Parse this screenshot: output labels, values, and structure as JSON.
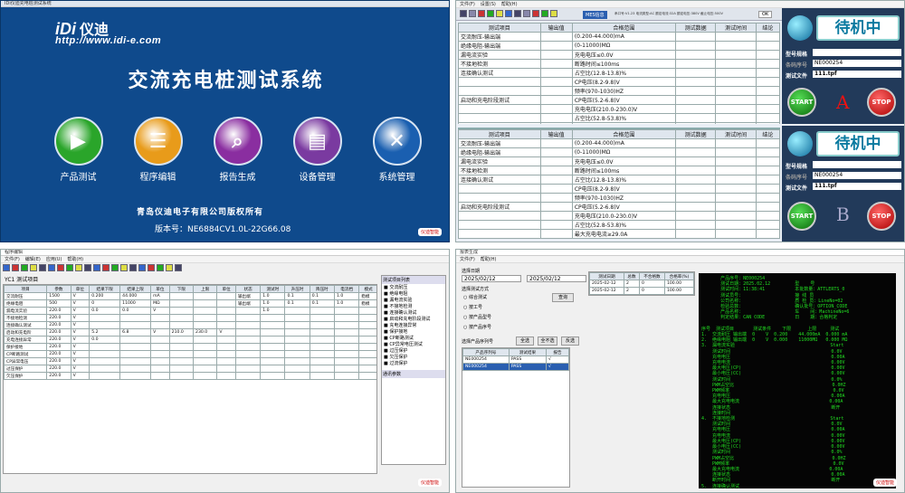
{
  "home": {
    "window_title": "IDi仪迪充电桩测试系统",
    "logo": "iDi",
    "logo_cn": "仪迪",
    "url": "http://www.idi-e.com",
    "title": "交流充电桩测试系统",
    "buttons": [
      {
        "label": "产品测试",
        "icon": "play-icon",
        "color": "#2aa52a"
      },
      {
        "label": "程序编辑",
        "icon": "document-icon",
        "color": "#e89b1a"
      },
      {
        "label": "报告生成",
        "icon": "magnifier-icon",
        "color": "#8a2ea0"
      },
      {
        "label": "设备管理",
        "icon": "bar-chart-icon",
        "color": "#7a3aa0"
      },
      {
        "label": "系统管理",
        "icon": "tools-icon",
        "color": "#1a5fb0"
      }
    ],
    "copyright": "青岛仪迪电子有限公司版权所有",
    "version_label": "版本号：",
    "version": "NE6884CV1.0L-22G66.08",
    "brand": "仪迪智能"
  },
  "test": {
    "menu": [
      "文件(F)",
      "设置(S)",
      "帮助(H)"
    ],
    "mes_label": "MES信息",
    "status_line": "串口号:V1.23 电流类型:AC 额定电流:32A 额定电压:380V 截止电压:500V",
    "ok_label": "OK",
    "columns": [
      "测试项目",
      "输出值",
      "合格范围",
      "测试数据",
      "测试时间",
      "结论"
    ],
    "rows": [
      [
        "交流耐压-输出端",
        "",
        "(0.200-44.000)mA",
        "",
        "",
        ""
      ],
      [
        "绝缘电阻-输出端",
        "",
        "(0-11000)MΩ",
        "",
        "",
        ""
      ],
      [
        "漏电流实验",
        "",
        "充电电压≤0.0V",
        "",
        "",
        ""
      ],
      [
        "不接地检测",
        "",
        "断路时间≤100ms",
        "",
        "",
        ""
      ],
      [
        "连接确认测试",
        "",
        "占空比(12.8-13.8)%",
        "",
        "",
        ""
      ],
      [
        "",
        "",
        "CP电压(8.2-9.8)V",
        "",
        "",
        ""
      ],
      [
        "",
        "",
        "频率(970-1030)HZ",
        "",
        "",
        ""
      ],
      [
        "启动和充电阶段测试",
        "",
        "CP电压(5.2-6.8)V",
        "",
        "",
        ""
      ],
      [
        "",
        "",
        "充电电压(210.0-230.0)V",
        "",
        "",
        ""
      ],
      [
        "",
        "",
        "占空比(52.8-53.8)%",
        "",
        "",
        ""
      ],
      [
        "",
        "",
        "最大充电电流≥29.0A",
        "",
        "",
        ""
      ]
    ],
    "standby": "待机中",
    "model_label": "型号规格",
    "serial_label": "条码序号",
    "serial_value": "NE000254",
    "file_label": "测试文件",
    "file_value": "111.tpf",
    "start": "START",
    "stop": "STOP",
    "station_a": "A",
    "station_b": "B"
  },
  "editor": {
    "window_title": "程序编辑",
    "menu": [
      "文件(F)",
      "编辑(E)",
      "应用(U)",
      "帮助(H)"
    ],
    "section": "YC1 测试项目",
    "columns": [
      "项目",
      "参数",
      "单位",
      "结果下限",
      "结果上限",
      "单位",
      "下限",
      "上限",
      "单位",
      "状态",
      "测试时",
      "升压时",
      "降压时",
      "电流档",
      "模式"
    ],
    "rows": [
      [
        "交流耐压",
        "1500",
        "V",
        "0.200",
        "44.000",
        "mA",
        "",
        "",
        "",
        "输出端",
        "1.0",
        "0.1",
        "0.1",
        "1.0",
        "稳模"
      ],
      [
        "绝缘电阻",
        "500",
        "V",
        "0",
        "11000",
        "MΩ",
        "",
        "",
        "",
        "输出端",
        "1.0",
        "0.1",
        "0.1",
        "1.0",
        "稳模"
      ],
      [
        "漏电流实验",
        "220.0",
        "V",
        "0.0",
        "0.0",
        "V",
        "",
        "",
        "",
        "",
        "1.0",
        "",
        "",
        "",
        ""
      ],
      [
        "不接地检测",
        "220.0",
        "V",
        "",
        "",
        "",
        "",
        "",
        "",
        "",
        "",
        "",
        "",
        "",
        ""
      ],
      [
        "连接确认测试",
        "220.0",
        "V",
        "",
        "",
        "",
        "",
        "",
        "",
        "",
        "",
        "",
        "",
        "",
        ""
      ],
      [
        "启动和充电阶",
        "220.0",
        "V",
        "5.2",
        "6.8",
        "V",
        "210.0",
        "230.0",
        "V",
        "",
        "",
        "",
        "",
        "",
        ""
      ],
      [
        "充电连接异常",
        "220.0",
        "V",
        "0.0",
        "",
        "",
        "",
        "",
        "",
        "",
        "",
        "",
        "",
        "",
        ""
      ],
      [
        "保护接地",
        "220.0",
        "V",
        "",
        "",
        "",
        "",
        "",
        "",
        "",
        "",
        "",
        "",
        "",
        ""
      ],
      [
        "CP断路测试",
        "220.0",
        "V",
        "",
        "",
        "",
        "",
        "",
        "",
        "",
        "",
        "",
        "",
        "",
        ""
      ],
      [
        "CP异常电压",
        "220.0",
        "V",
        "",
        "",
        "",
        "",
        "",
        "",
        "",
        "",
        "",
        "",
        "",
        ""
      ],
      [
        "过压保护",
        "220.0",
        "V",
        "",
        "",
        "",
        "",
        "",
        "",
        "",
        "",
        "",
        "",
        "",
        ""
      ],
      [
        "欠压保护",
        "220.0",
        "V",
        "",
        "",
        "",
        "",
        "",
        "",
        "",
        "",
        "",
        "",
        "",
        ""
      ]
    ],
    "list_title": "测试项目列表",
    "list_items": [
      "交流耐压",
      "绝缘电阻",
      "漏电流实验",
      "不接地检测",
      "连接确认测试",
      "启动和充电阶段测试",
      "充电连接异常",
      "保护接地",
      "CP断路测试",
      "CP异常电压测试",
      "过压保护",
      "欠压保护",
      "过流保护"
    ],
    "param_title": "通讯参数",
    "set_label": "设置"
  },
  "report": {
    "window_title": "报表生成",
    "menu": [
      "文件(F)",
      "帮助(H)"
    ],
    "date_label": "选择日期",
    "date_from": "2025/02/12",
    "date_to": "2025/02/12",
    "mode_label": "选择测试方式",
    "options": [
      "综合测试",
      "按工号",
      "按产品型号",
      "按产品序号"
    ],
    "query": "查询",
    "table_cols": [
      "测试日期",
      "总数",
      "不合格数",
      "合格率(%)"
    ],
    "table_rows": [
      [
        "2025-02-12",
        "2",
        "0",
        "100.00"
      ],
      [
        "2025-02-12",
        "2",
        "0",
        "100.00"
      ]
    ],
    "serial_label": "选择产品序列号",
    "btn_all": "全选",
    "btn_none": "全不选",
    "btn_inv": "反选",
    "serial_cols": [
      "产品序列号",
      "测试结果",
      "报告"
    ],
    "serials": [
      [
        "NE000254",
        "PASS",
        "√"
      ],
      [
        "NE000254",
        "PASS",
        "√"
      ]
    ],
    "lcd_text": "       产品序号：NE000254\n       测试日期：2025.02.12         型    号\n       测试时间：11:38:41           本批数量：ATTLERTS_0\n       测试员号：                   接 线 员\n       公司名称：                   质 检 员：LineNo=02\n       检验总数：                   确认批号：OPTION_CODE\n       产品名称：                   车    间：MachineNo=6\n       判定结果：CAN CODE           日    期：合格判定\n\n序号  测试项目       测试条件    下限      上限     测试\n1.  交流耐压 输出端  0    V  0.200    44.000mA  0.000 mA\n2.  绝缘电阻 输出端  0    V  0.000    11000MΩ   0.000 MΩ\n3.  漏电流实验                                   Start\n    测试时间                                     0.0V\n    充电电压                                     0.00A\n    充电电流                                     0.00V\n    最大电压(CP)                                 0.00V\n    最小电压(CC)                                 0.00V\n    测试时间                                     0.0%\n    PWM占空比                                    0.0HZ\n    PWM频率                                      0.0V\n    充电电压                                     0.00A\n    最大充电电流                                 0.00A\n    连接状态                                     断开\n    连接时间\n4.  不接地检测                                   Start\n    测试时间                                     0.0V\n    充电电压                                     0.00A\n    充电电流                                     0.00V\n    最大电压(CP)                                 0.00V\n    最小电压(CC)                                 0.00V\n    测试时间                                     0.0%\n    PWM占空比                                    0.0HZ\n    PWM频率                                      0.0V\n    最大充电电流                                 0.00A\n    连接状态                                     0.00A\n    断开时间                                     断开\n5.  连接确认测试"
  }
}
